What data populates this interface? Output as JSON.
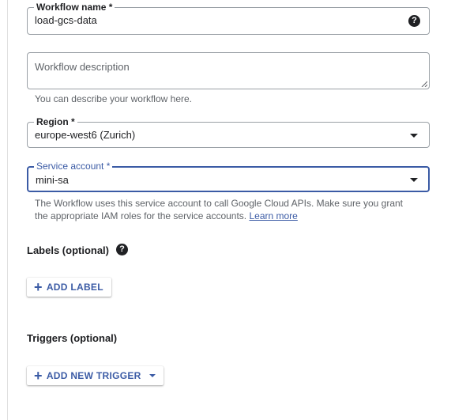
{
  "workflow_name": {
    "label": "Workflow name *",
    "value": "load-gcs-data",
    "help_icon": "?"
  },
  "description": {
    "placeholder": "Workflow description",
    "hint": "You can describe your workflow here."
  },
  "region": {
    "label": "Region *",
    "value": "europe-west6 (Zurich)"
  },
  "service_account": {
    "label": "Service account *",
    "value": "mini-sa",
    "hint_line1": "The Workflow uses this service account to call Google Cloud APIs. Make sure you grant",
    "hint_line2": "the appropriate IAM roles for the service accounts.",
    "learn_more": "Learn more"
  },
  "labels": {
    "title": "Labels (optional)",
    "help_icon": "?",
    "add_button": "ADD LABEL"
  },
  "triggers": {
    "title": "Triggers (optional)",
    "add_button": "ADD NEW TRIGGER"
  },
  "colors": {
    "accent": "#3b5ba5",
    "border": "#9aa0a6",
    "hint": "#5f6368"
  }
}
